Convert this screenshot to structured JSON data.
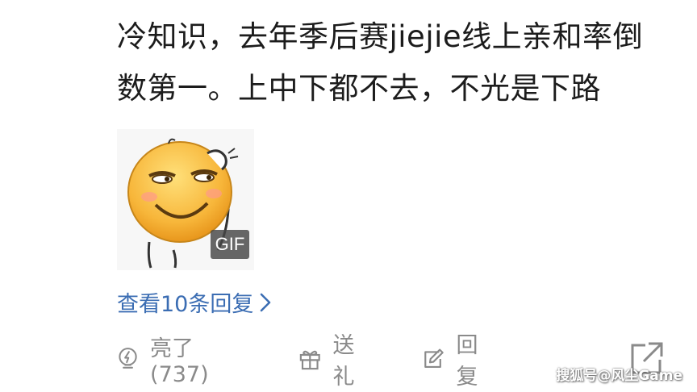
{
  "comment": {
    "line1": "冷知识，去年季后赛jiejie线上亲和率倒",
    "line2": "数第一。上中下都不去，不光是下路"
  },
  "media": {
    "badge": "GIF",
    "icon": "smiley-hand-on-head-emoji"
  },
  "replies": {
    "label": "查看10条回复",
    "icon": "chevron-right-icon"
  },
  "actions": {
    "like": {
      "label": "亮了(737)",
      "icon": "lightbulb-icon"
    },
    "gift": {
      "label": "送礼",
      "icon": "gift-icon"
    },
    "reply": {
      "label": "回复",
      "icon": "edit-icon"
    },
    "share": {
      "icon": "share-icon"
    }
  },
  "watermark": "搜狐号@风尘Game",
  "colors": {
    "link": "#3b6db3",
    "muted": "#8a8a8a",
    "text": "#1c1c1c"
  }
}
